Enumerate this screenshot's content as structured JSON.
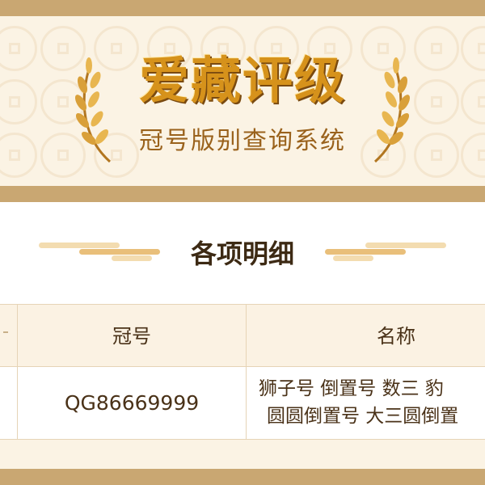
{
  "header": {
    "logo_text": "爱藏评级",
    "subtitle": "冠号版别查询系统"
  },
  "section": {
    "title": "各项明细"
  },
  "table": {
    "columns": [
      "冠号",
      "名称"
    ],
    "rows": [
      {
        "code": "QG86669999",
        "name_line1": "狮子号 倒置号 数三 豹",
        "name_line2": "圆圆倒置号 大三圆倒置"
      }
    ]
  },
  "colors": {
    "border_gold": "#c9a772",
    "header_bg": "#fbf3e4",
    "logo_gold": "#d6921b",
    "text_brown": "#4a3218"
  }
}
